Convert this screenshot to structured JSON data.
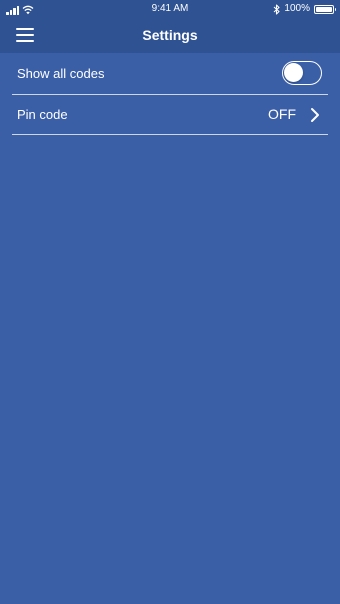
{
  "status_bar": {
    "time": "9:41 AM",
    "battery_percent": "100%",
    "battery_level": 1.0,
    "icons": [
      "signal-icon",
      "wifi-icon",
      "bluetooth-icon",
      "battery-icon"
    ]
  },
  "nav": {
    "title": "Settings",
    "menu_icon": "hamburger-menu-icon"
  },
  "settings": {
    "show_all_codes": {
      "label": "Show all codes",
      "enabled": false
    },
    "pin_code": {
      "label": "Pin code",
      "value": "OFF",
      "icon": "chevron-right-icon"
    }
  },
  "colors": {
    "background": "#3a5fa7",
    "header": "#2f5293",
    "text": "#ffffff"
  }
}
